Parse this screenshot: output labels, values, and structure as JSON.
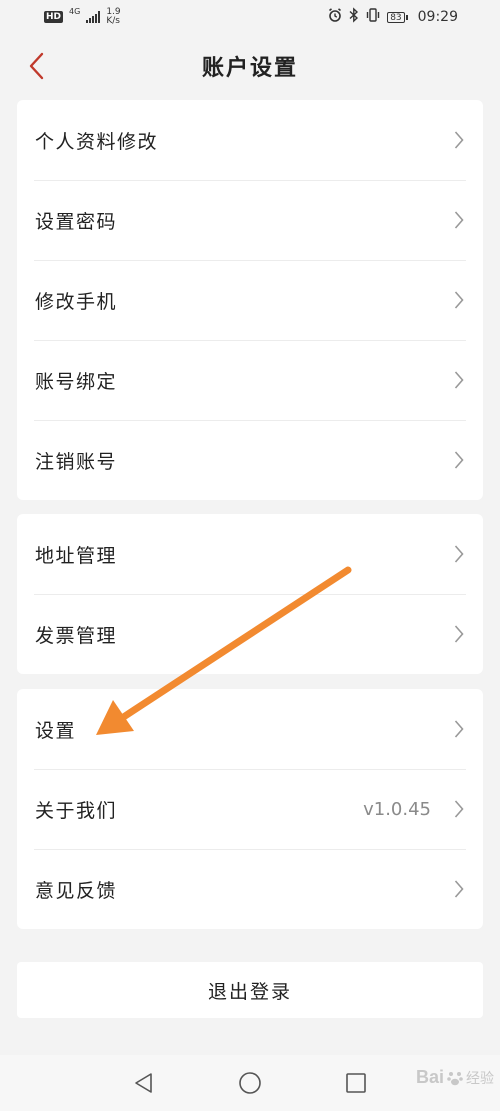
{
  "status_bar": {
    "hd": "HD",
    "network": "4G",
    "speed_value": "1.9",
    "speed_unit": "K/s",
    "battery": "83",
    "time": "09:29"
  },
  "header": {
    "title": "账户设置"
  },
  "groups": [
    {
      "items": [
        {
          "label": "个人资料修改"
        },
        {
          "label": "设置密码"
        },
        {
          "label": "修改手机"
        },
        {
          "label": "账号绑定"
        },
        {
          "label": "注销账号"
        }
      ]
    },
    {
      "items": [
        {
          "label": "地址管理"
        },
        {
          "label": "发票管理"
        }
      ]
    },
    {
      "items": [
        {
          "label": "设置"
        },
        {
          "label": "关于我们",
          "value": "v1.0.45"
        },
        {
          "label": "意见反馈"
        }
      ]
    }
  ],
  "logout_label": "退出登录",
  "watermark": {
    "brand": "Bai",
    "suffix": "经验"
  },
  "colors": {
    "accent": "#c0392b",
    "annotation": "#f28a30"
  }
}
